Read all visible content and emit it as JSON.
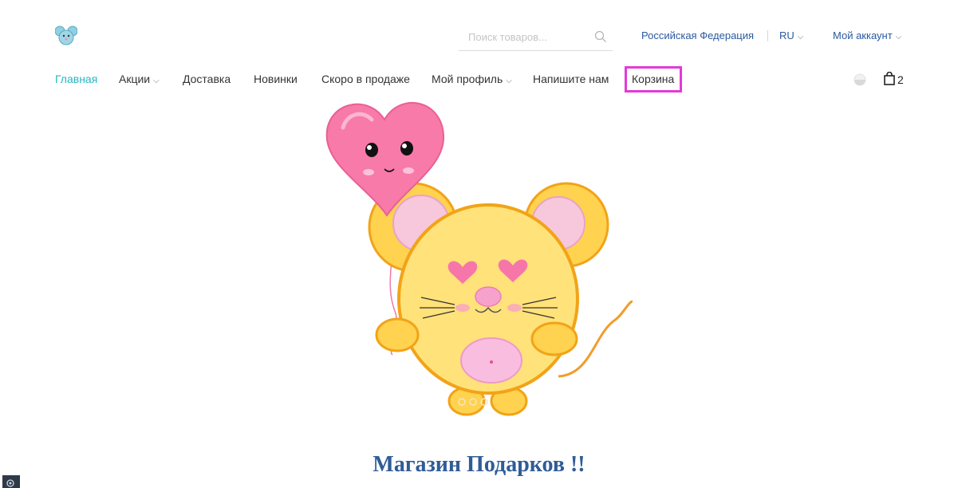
{
  "header": {
    "search": {
      "placeholder": "Поиск товаров..."
    },
    "country": "Российская Федерация",
    "language": "RU",
    "account": "Мой аккаунт"
  },
  "nav": {
    "items": [
      {
        "label": "Главная",
        "active": true,
        "dropdown": false
      },
      {
        "label": "Акции",
        "active": false,
        "dropdown": true
      },
      {
        "label": "Доставка",
        "active": false,
        "dropdown": false
      },
      {
        "label": "Новинки",
        "active": false,
        "dropdown": false
      },
      {
        "label": "Скоро в продаже",
        "active": false,
        "dropdown": false
      },
      {
        "label": "Мой профиль",
        "active": false,
        "dropdown": true
      },
      {
        "label": "Напишите нам",
        "active": false,
        "dropdown": false
      },
      {
        "label": "Корзина",
        "active": false,
        "dropdown": false,
        "highlighted": true
      }
    ],
    "cart_count": "2"
  },
  "main": {
    "title": "Магазин Подарков !!",
    "hero_image": "cartoon-mouse-with-heart-balloon"
  },
  "colors": {
    "accent": "#2bb5c0",
    "link": "#2a5aa0",
    "highlight": "#e23ad9",
    "title": "#2f5c97"
  }
}
